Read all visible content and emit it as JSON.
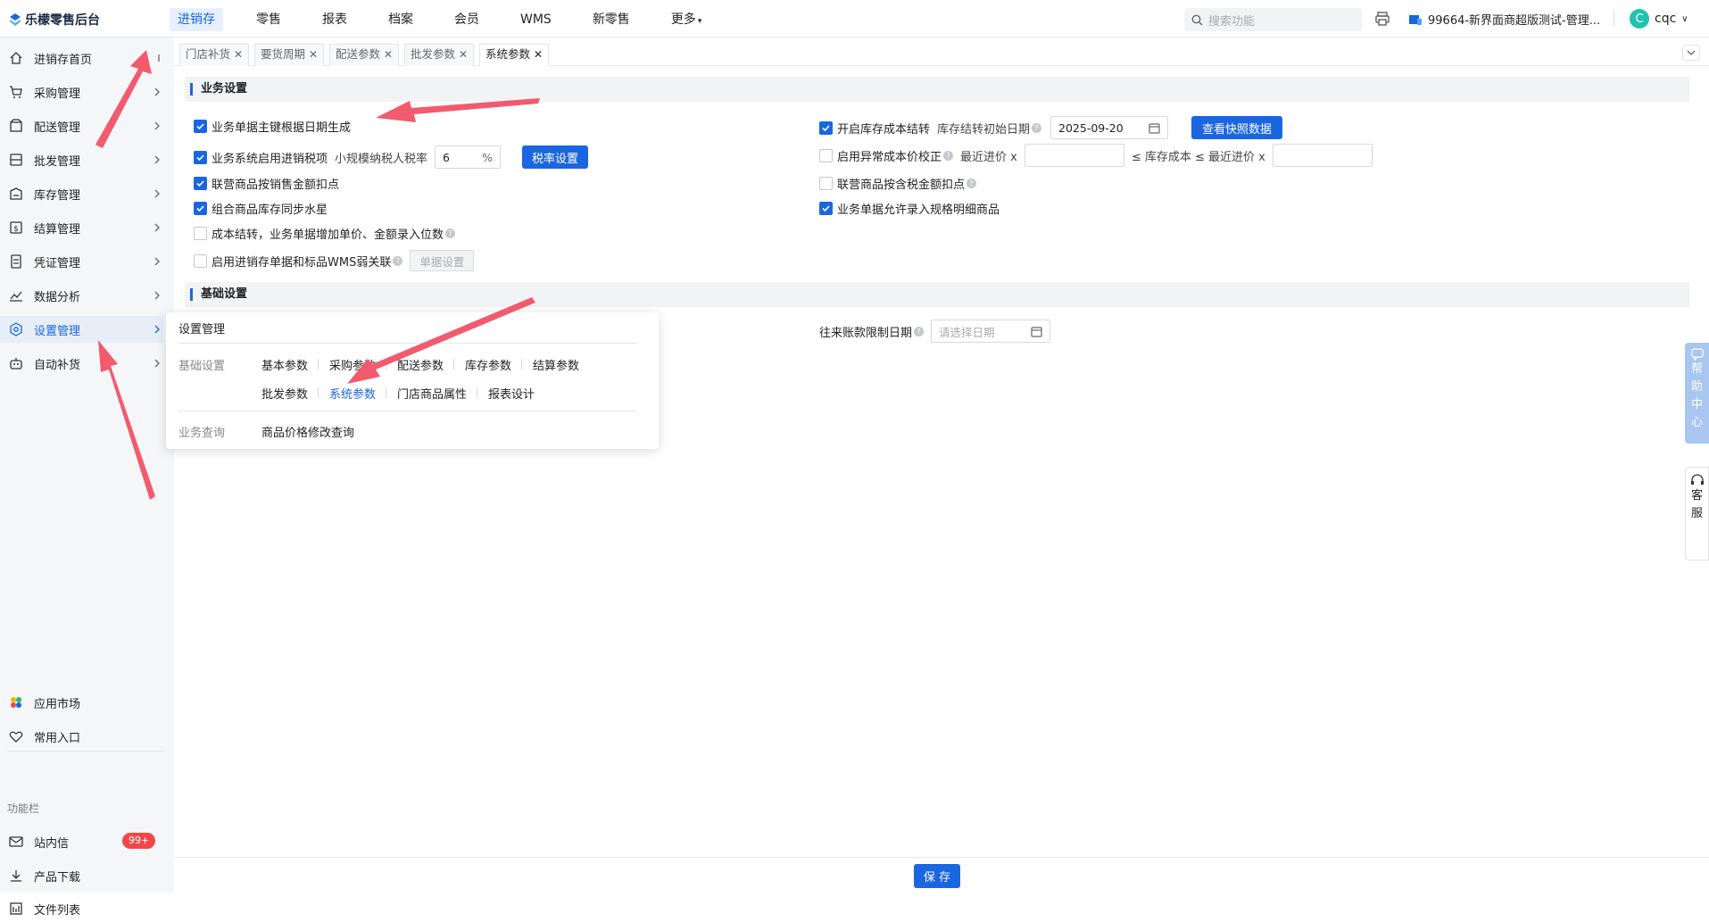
{
  "header": {
    "logo": "乐檬零售后台",
    "nav": [
      "进销存",
      "零售",
      "报表",
      "档案",
      "会员",
      "WMS",
      "新零售",
      "更多"
    ],
    "search_placeholder": "搜索功能",
    "store": "99664-新界面商超版测试-管理...",
    "user_initial": "C",
    "user_name": "cqc"
  },
  "sidebar": {
    "items": [
      "进销存首页",
      "采购管理",
      "配送管理",
      "批发管理",
      "库存管理",
      "结算管理",
      "凭证管理",
      "数据分析",
      "设置管理",
      "自动补货"
    ],
    "bottom_items": [
      "应用市场",
      "常用入口"
    ],
    "section_label": "功能栏",
    "func_items": [
      "站内信",
      "产品下载",
      "文件列表"
    ],
    "badge": "99+"
  },
  "tabs": [
    "门店补货",
    "要货周期",
    "配送参数",
    "批发参数",
    "系统参数"
  ],
  "business": {
    "title": "业务设置",
    "left": {
      "r1": "业务单据主键根据日期生成",
      "r2": "业务系统启用进销税项",
      "r2_rate_label": "小规模纳税人税率",
      "r2_rate_value": "6",
      "r2_unit": "%",
      "r2_btn": "税率设置",
      "r3": "联营商品按销售金额扣点",
      "r4": "组合商品库存同步水星",
      "r5": "成本结转，业务单据增加单价、金额录入位数",
      "r6": "启用进销存单据和标品WMS弱关联",
      "r6_btn": "单据设置"
    },
    "right": {
      "r1": "开启库存成本结转",
      "r1_date_label": "库存结转初始日期",
      "r1_date": "2025-09-20",
      "r1_btn": "查看快照数据",
      "r2": "启用异常成本价校正",
      "r2_a": "最近进价 x",
      "r2_b": "≤ 库存成本 ≤ 最近进价 x",
      "r3": "联营商品按含税金额扣点",
      "r4": "业务单据允许录入规格明细商品"
    }
  },
  "basic": {
    "title": "基础设置",
    "limit_label": "往来账款限制日期",
    "limit_placeholder": "请选择日期"
  },
  "popup": {
    "title": "设置管理",
    "cat1": "基础设置",
    "links_row1": [
      "基本参数",
      "采购参数",
      "配送参数",
      "库存参数",
      "结算参数"
    ],
    "links_row2": [
      "批发参数",
      "系统参数",
      "门店商品属性",
      "报表设计"
    ],
    "cat2": "业务查询",
    "links_row3": [
      "商品价格修改查询"
    ]
  },
  "footer": {
    "save": "保 存"
  },
  "right_tabs": {
    "help": [
      "帮",
      "助",
      "中",
      "心"
    ],
    "service": [
      "客",
      "服"
    ]
  },
  "colors": {
    "primary": "#1a66e0",
    "arrow": "#f25a6e",
    "badge": "#f04848"
  }
}
